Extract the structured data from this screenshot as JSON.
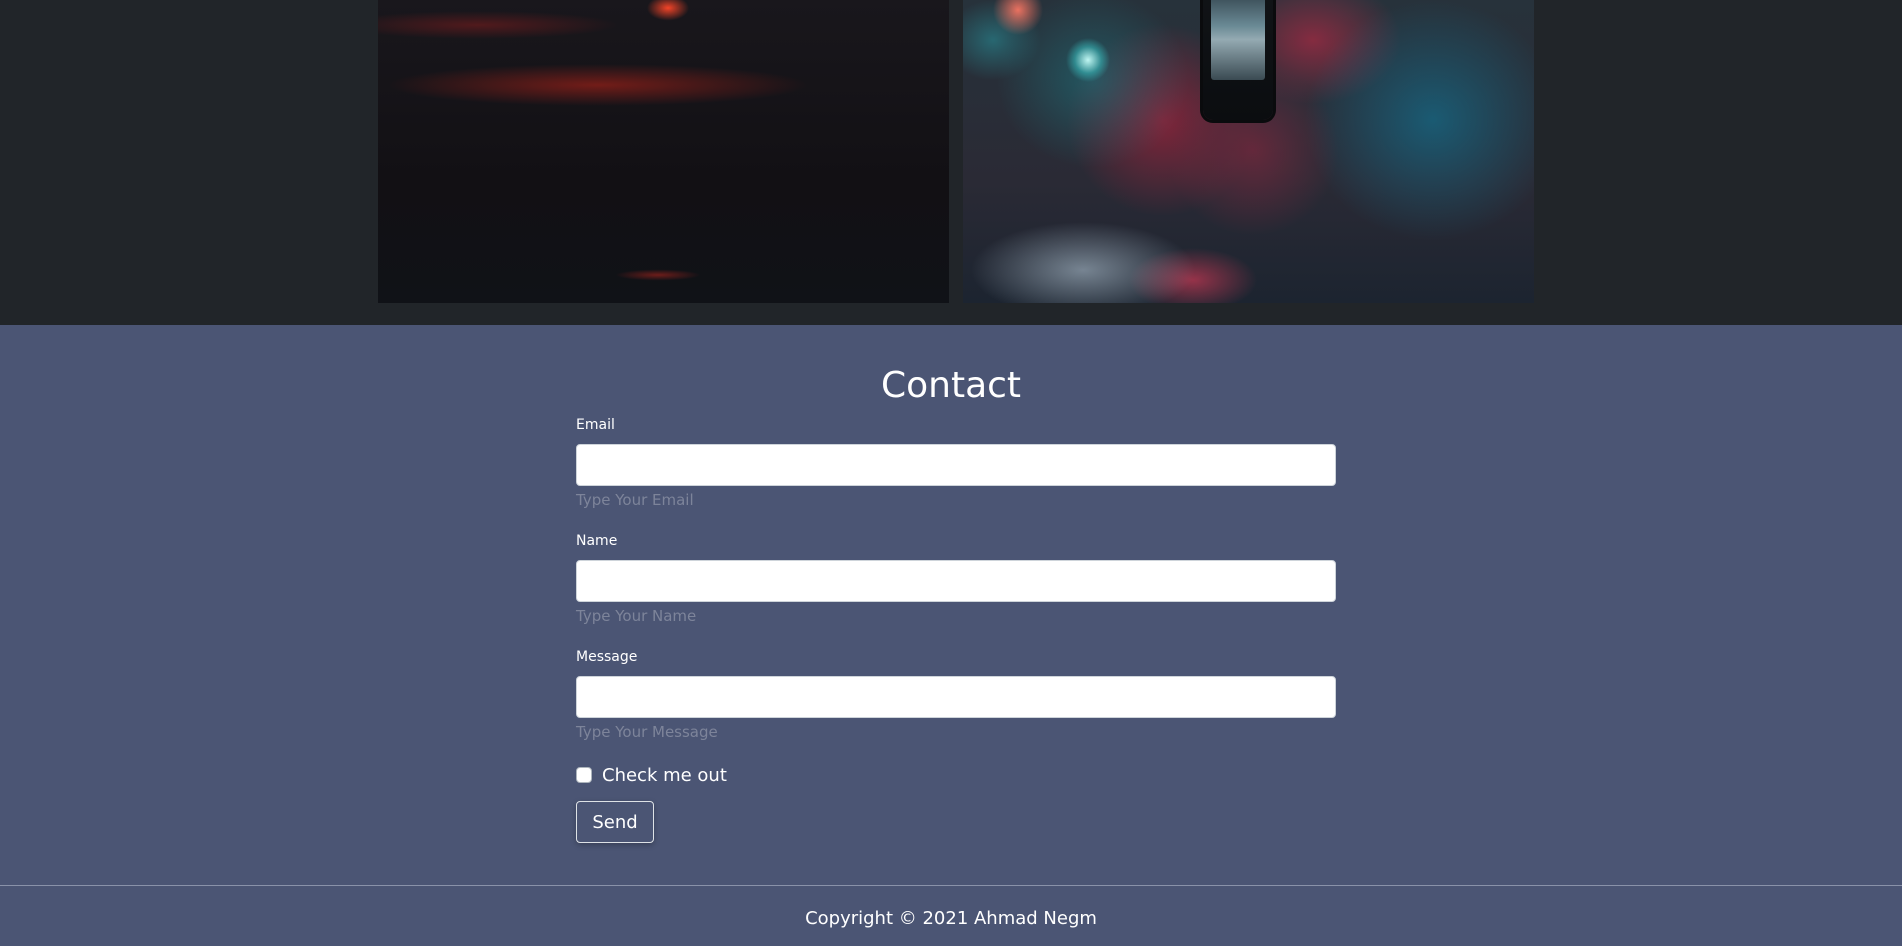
{
  "gallery": {
    "images": [
      {
        "name": "night-street-photo"
      },
      {
        "name": "phone-in-crowd-photo"
      }
    ]
  },
  "contact": {
    "title": "Contact",
    "email": {
      "label": "Email",
      "value": "",
      "hint": "Type Your Email"
    },
    "name": {
      "label": "Name",
      "value": "",
      "hint": "Type Your Name"
    },
    "message": {
      "label": "Message",
      "value": "",
      "hint": "Type Your Message"
    },
    "checkbox": {
      "label": "Check me out",
      "checked": false
    },
    "submit_label": "Send"
  },
  "footer": {
    "copyright": "Copyright © 2021 Ahmad Negm"
  },
  "colors": {
    "gallery_bg": "#212529",
    "contact_bg": "#4b5574",
    "hint_text": "#7d849a"
  }
}
